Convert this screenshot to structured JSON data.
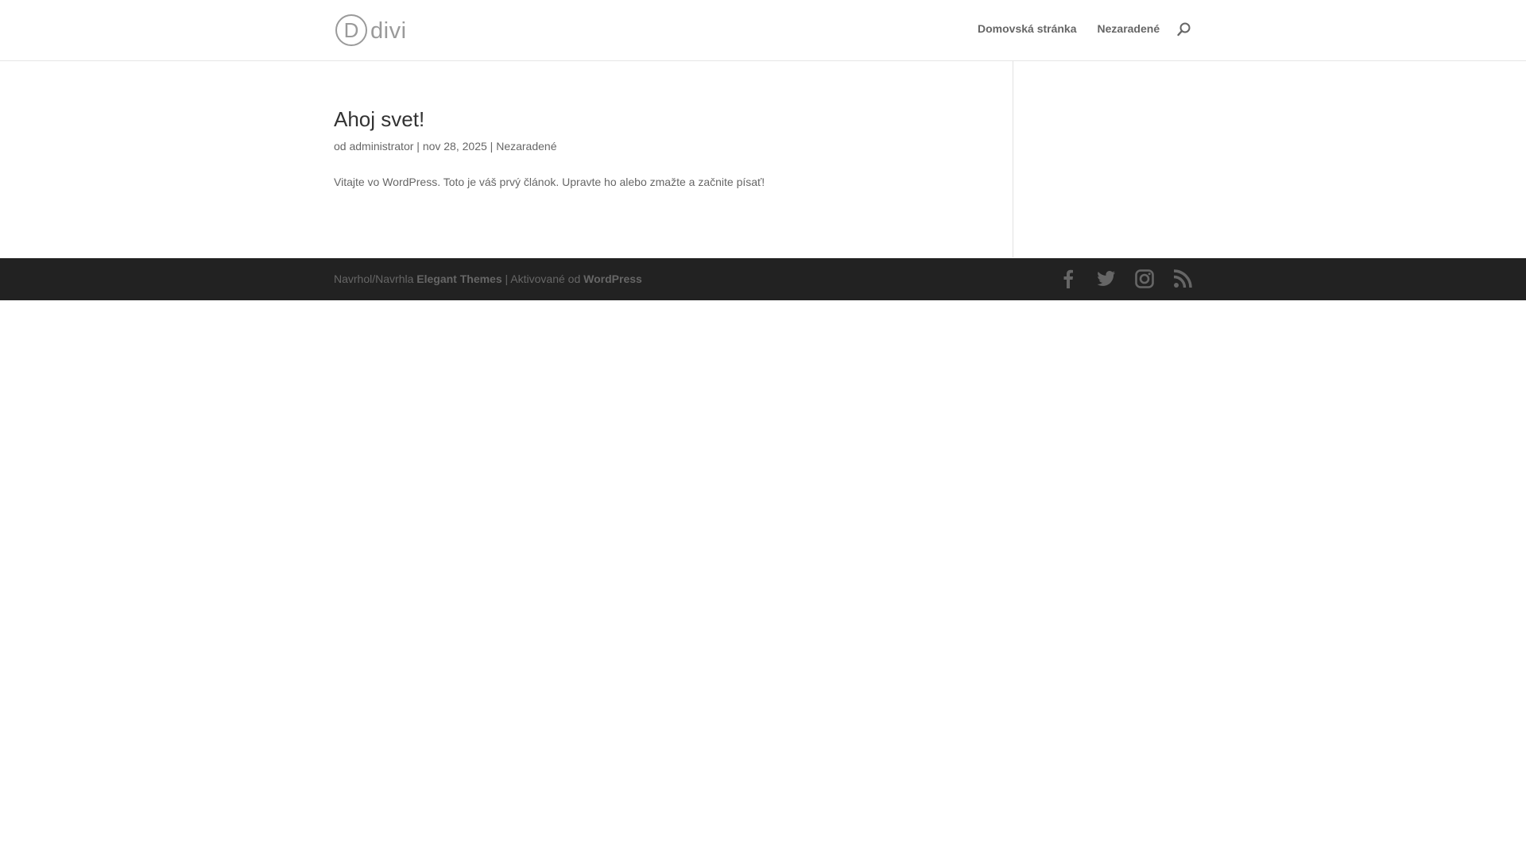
{
  "header": {
    "logo_letter": "D",
    "logo_word": "divi",
    "menu": [
      {
        "label": "Domovská stránka"
      },
      {
        "label": "Nezaradené"
      }
    ]
  },
  "post": {
    "title": "Ahoj svet!",
    "meta_prefix": "od",
    "author": "administrator",
    "separator": "|",
    "date": "nov 28, 2025",
    "category": "Nezaradené",
    "excerpt": "Vitajte vo WordPress. Toto je váš prvý článok. Upravte ho alebo zmažte a začnite písať!"
  },
  "footer": {
    "designed_by": "Navrhol/Navrhla",
    "theme_name": "Elegant Themes",
    "separator": "|",
    "powered_by": "Aktivované od",
    "platform": "WordPress",
    "social": [
      "facebook-icon",
      "twitter-icon",
      "instagram-icon",
      "rss-icon"
    ]
  },
  "colors": {
    "text": "#666666",
    "title": "#333333",
    "footer_bg": "#222222",
    "icon": "#666666"
  }
}
